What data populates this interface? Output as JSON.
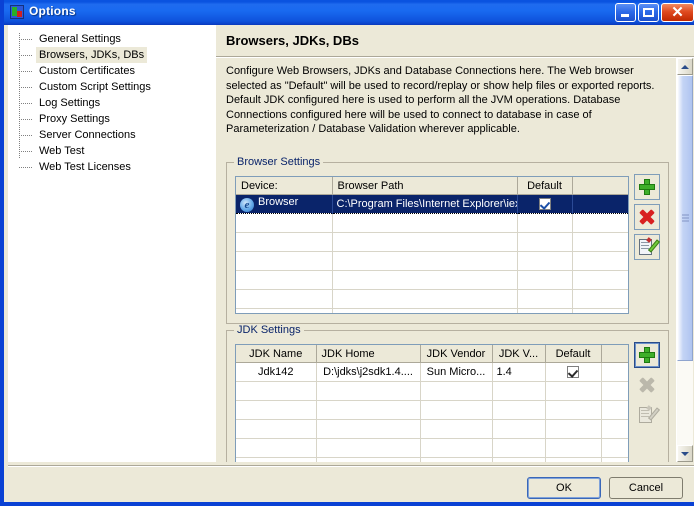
{
  "window": {
    "title": "Options",
    "icon": "options-app-icon",
    "buttons": {
      "minimize": "minimize-icon",
      "maximize": "maximize-icon",
      "close": "✕"
    }
  },
  "sidebar": {
    "items": [
      {
        "label": "General Settings",
        "selected": false
      },
      {
        "label": "Browsers, JDKs, DBs",
        "selected": true
      },
      {
        "label": "Custom Certificates",
        "selected": false
      },
      {
        "label": "Custom Script Settings",
        "selected": false
      },
      {
        "label": "Log Settings",
        "selected": false
      },
      {
        "label": "Proxy Settings",
        "selected": false
      },
      {
        "label": "Server Connections",
        "selected": false
      },
      {
        "label": "Web Test",
        "selected": false
      },
      {
        "label": "Web Test Licenses",
        "selected": false
      }
    ]
  },
  "main": {
    "page_title": "Browsers, JDKs, DBs",
    "description": "Configure Web Browsers, JDKs and Database Connections here. The Web browser selected as \"Default\" will be used to record/replay or show help files or exported reports. Default JDK configured here is used to perform all the JVM operations. Database Connections configured here will be used to connect to database in case of Parameterization / Database Validation wherever applicable.",
    "browser_settings": {
      "group_title": "Browser Settings",
      "columns": [
        "Device:",
        "Browser Path",
        "Default",
        ""
      ],
      "rows": [
        {
          "device": "Browser",
          "path": "C:\\Program Files\\Internet Explorer\\iexplore.exe",
          "default_checked": true,
          "selected": true,
          "icon": "internet-explorer-icon"
        }
      ],
      "empty_row_count": 5,
      "actions": [
        {
          "name": "add-browser-button",
          "icon": "plus-icon",
          "enabled": true
        },
        {
          "name": "delete-browser-button",
          "icon": "delete-x-icon",
          "enabled": true
        },
        {
          "name": "edit-browser-button",
          "icon": "edit-pencil-icon",
          "enabled": true
        }
      ]
    },
    "jdk_settings": {
      "group_title": "JDK Settings",
      "columns": [
        "JDK Name",
        "JDK Home",
        "JDK Vendor",
        "JDK V...",
        "Default",
        ""
      ],
      "rows": [
        {
          "name": "Jdk142",
          "home": "D:\\jdks\\j2sdk1.4....",
          "vendor": "Sun Micro...",
          "version": "1.4",
          "default_checked": true
        }
      ],
      "empty_row_count": 5,
      "actions": [
        {
          "name": "add-jdk-button",
          "icon": "plus-icon",
          "enabled": true
        },
        {
          "name": "delete-jdk-button",
          "icon": "delete-x-icon",
          "enabled": false
        },
        {
          "name": "edit-jdk-button",
          "icon": "edit-pencil-icon",
          "enabled": false
        }
      ]
    },
    "scrollbar": {
      "up_arrow": "chevron-up-icon",
      "down_arrow": "chevron-down-icon",
      "thumb_position_percent": 0,
      "thumb_size_percent": 78
    }
  },
  "footer": {
    "ok_label": "OK",
    "cancel_label": "Cancel"
  },
  "colors": {
    "titlebar_blue": "#0A53E0",
    "window_border": "#0A41D4",
    "dialog_face": "#ECE9D8",
    "selection_blue": "#0A246A",
    "group_title": "#0A246A",
    "grid_header": "#ECE9D8",
    "close_red": "#E04A20"
  }
}
